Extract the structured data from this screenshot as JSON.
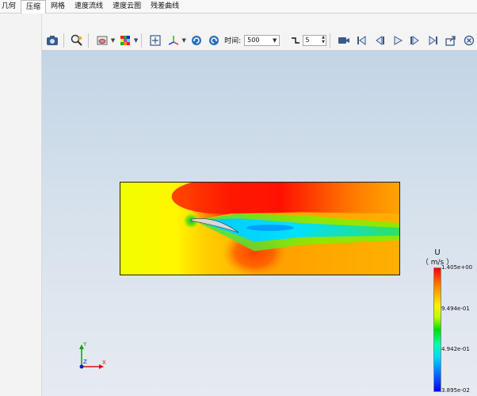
{
  "menu": {
    "items": [
      "几何",
      "压缩",
      "网格",
      "速度流线",
      "速度云图",
      "残差曲线"
    ],
    "active_index": 1
  },
  "toolbar": {
    "time_label": "时间:",
    "time_value": "500",
    "step_value": "5",
    "icons": [
      "camera-icon",
      "zoom-icon",
      "surface-display-icon",
      "color-cube-icon",
      "fit-view-icon",
      "axes-rotate-icon",
      "rotate-left-icon",
      "rotate-right-icon",
      "step-icon",
      "record-video-icon",
      "first-frame-icon",
      "previous-frame-icon",
      "play-icon",
      "next-frame-icon",
      "last-frame-icon",
      "export-icon",
      "close-icon"
    ]
  },
  "legend": {
    "variable": "U",
    "unit": "（ m/s ）",
    "ticks": [
      "1.405e+00",
      "9.494e-01",
      "4.942e-01",
      "3.895e-02"
    ],
    "colors": [
      "#ff0000",
      "#ffee00",
      "#00e000",
      "#00d8ff",
      "#0000ff"
    ]
  },
  "axes": {
    "x": "X",
    "y": "Y",
    "z": "Z"
  }
}
